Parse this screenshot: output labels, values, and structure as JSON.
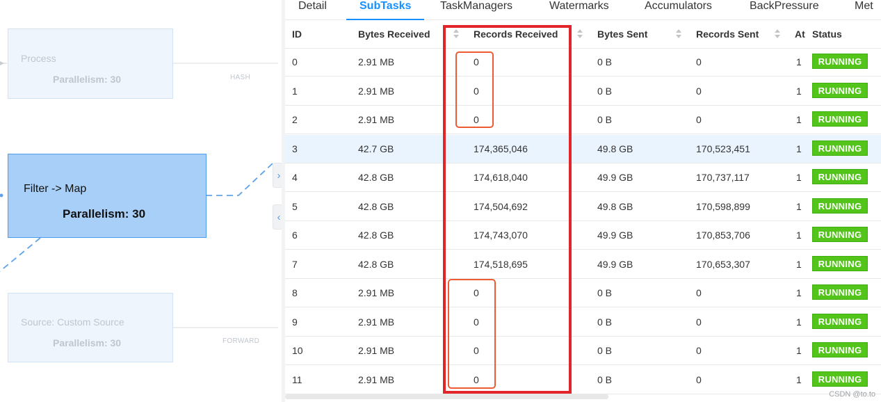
{
  "graph": {
    "nodes": [
      {
        "name": "Process",
        "parallelism": "Parallelism: 30"
      },
      {
        "name": "Filter -> Map",
        "parallelism": "Parallelism: 30"
      },
      {
        "name": "Source: Custom Source",
        "parallelism": "Parallelism: 30"
      }
    ],
    "edges": [
      {
        "label": "HASH"
      },
      {
        "label": "FORWARD"
      }
    ],
    "handles": [
      {
        "glyph": "›"
      },
      {
        "glyph": "‹"
      }
    ]
  },
  "tabs": [
    {
      "label": "Detail",
      "active": false
    },
    {
      "label": "SubTasks",
      "active": true
    },
    {
      "label": "TaskManagers",
      "active": false
    },
    {
      "label": "Watermarks",
      "active": false
    },
    {
      "label": "Accumulators",
      "active": false
    },
    {
      "label": "BackPressure",
      "active": false
    },
    {
      "label": "Met",
      "active": false
    }
  ],
  "table": {
    "columns": [
      "ID",
      "Bytes Received",
      "Records Received",
      "Bytes Sent",
      "Records Sent",
      "At",
      "Status"
    ],
    "rows": [
      {
        "id": "0",
        "bytes_received": "2.91 MB",
        "records_received": "0",
        "bytes_sent": "0 B",
        "records_sent": "0",
        "attempt": "1",
        "status": "RUNNING"
      },
      {
        "id": "1",
        "bytes_received": "2.91 MB",
        "records_received": "0",
        "bytes_sent": "0 B",
        "records_sent": "0",
        "attempt": "1",
        "status": "RUNNING"
      },
      {
        "id": "2",
        "bytes_received": "2.91 MB",
        "records_received": "0",
        "bytes_sent": "0 B",
        "records_sent": "0",
        "attempt": "1",
        "status": "RUNNING"
      },
      {
        "id": "3",
        "bytes_received": "42.7 GB",
        "records_received": "174,365,046",
        "bytes_sent": "49.8 GB",
        "records_sent": "170,523,451",
        "attempt": "1",
        "status": "RUNNING"
      },
      {
        "id": "4",
        "bytes_received": "42.8 GB",
        "records_received": "174,618,040",
        "bytes_sent": "49.9 GB",
        "records_sent": "170,737,117",
        "attempt": "1",
        "status": "RUNNING"
      },
      {
        "id": "5",
        "bytes_received": "42.8 GB",
        "records_received": "174,504,692",
        "bytes_sent": "49.8 GB",
        "records_sent": "170,598,899",
        "attempt": "1",
        "status": "RUNNING"
      },
      {
        "id": "6",
        "bytes_received": "42.8 GB",
        "records_received": "174,743,070",
        "bytes_sent": "49.9 GB",
        "records_sent": "170,853,706",
        "attempt": "1",
        "status": "RUNNING"
      },
      {
        "id": "7",
        "bytes_received": "42.8 GB",
        "records_received": "174,518,695",
        "bytes_sent": "49.9 GB",
        "records_sent": "170,653,307",
        "attempt": "1",
        "status": "RUNNING"
      },
      {
        "id": "8",
        "bytes_received": "2.91 MB",
        "records_received": "0",
        "bytes_sent": "0 B",
        "records_sent": "0",
        "attempt": "1",
        "status": "RUNNING"
      },
      {
        "id": "9",
        "bytes_received": "2.91 MB",
        "records_received": "0",
        "bytes_sent": "0 B",
        "records_sent": "0",
        "attempt": "1",
        "status": "RUNNING"
      },
      {
        "id": "10",
        "bytes_received": "2.91 MB",
        "records_received": "0",
        "bytes_sent": "0 B",
        "records_sent": "0",
        "attempt": "1",
        "status": "RUNNING"
      },
      {
        "id": "11",
        "bytes_received": "2.91 MB",
        "records_received": "0",
        "bytes_sent": "0 B",
        "records_sent": "0",
        "attempt": "1",
        "status": "RUNNING"
      }
    ]
  },
  "colors": {
    "accent": "#1890ff",
    "running": "#52c41a",
    "active_node": "#a7cff7",
    "annotation_red": "#e2242b",
    "annotation_orange": "#ee5a32"
  },
  "watermark": "CSDN @to.to"
}
